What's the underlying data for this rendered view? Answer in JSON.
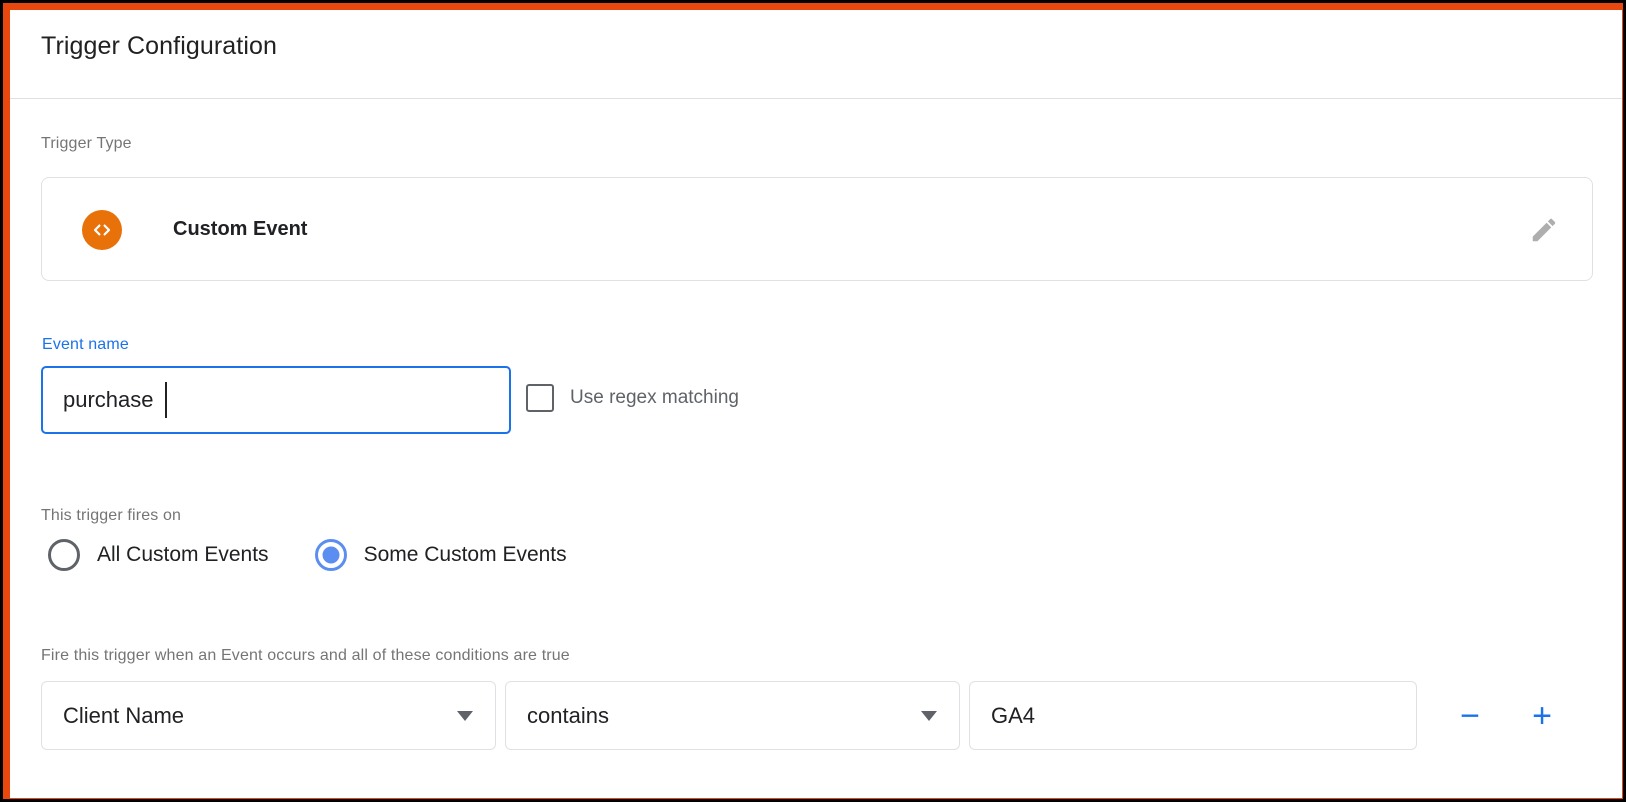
{
  "theme": {
    "frame_border_color": "#000000",
    "frame_accent_color": "#E8480E",
    "accent_blue": "#1a73e8",
    "radio_blue": "#5b8ef0",
    "icon_orange": "#E8710A",
    "muted_text": "#757575"
  },
  "header": {
    "title": "Trigger Configuration"
  },
  "trigger_type": {
    "label": "Trigger Type",
    "name": "Custom Event",
    "icon": "code-brackets-icon",
    "edit_icon": "pencil-icon"
  },
  "event_name": {
    "label": "Event name",
    "value": "purchase",
    "placeholder": "",
    "focused": true,
    "regex": {
      "label": "Use regex matching",
      "checked": false
    }
  },
  "fires_on": {
    "label": "This trigger fires on",
    "options": [
      {
        "label": "All Custom Events",
        "selected": false
      },
      {
        "label": "Some Custom Events",
        "selected": true
      }
    ]
  },
  "conditions": {
    "label": "Fire this trigger when an Event occurs and all of these conditions are true",
    "rows": [
      {
        "variable": "Client Name",
        "operator": "contains",
        "value": "GA4",
        "value_placeholder": ""
      }
    ],
    "remove_label": "−",
    "add_label": "+"
  }
}
